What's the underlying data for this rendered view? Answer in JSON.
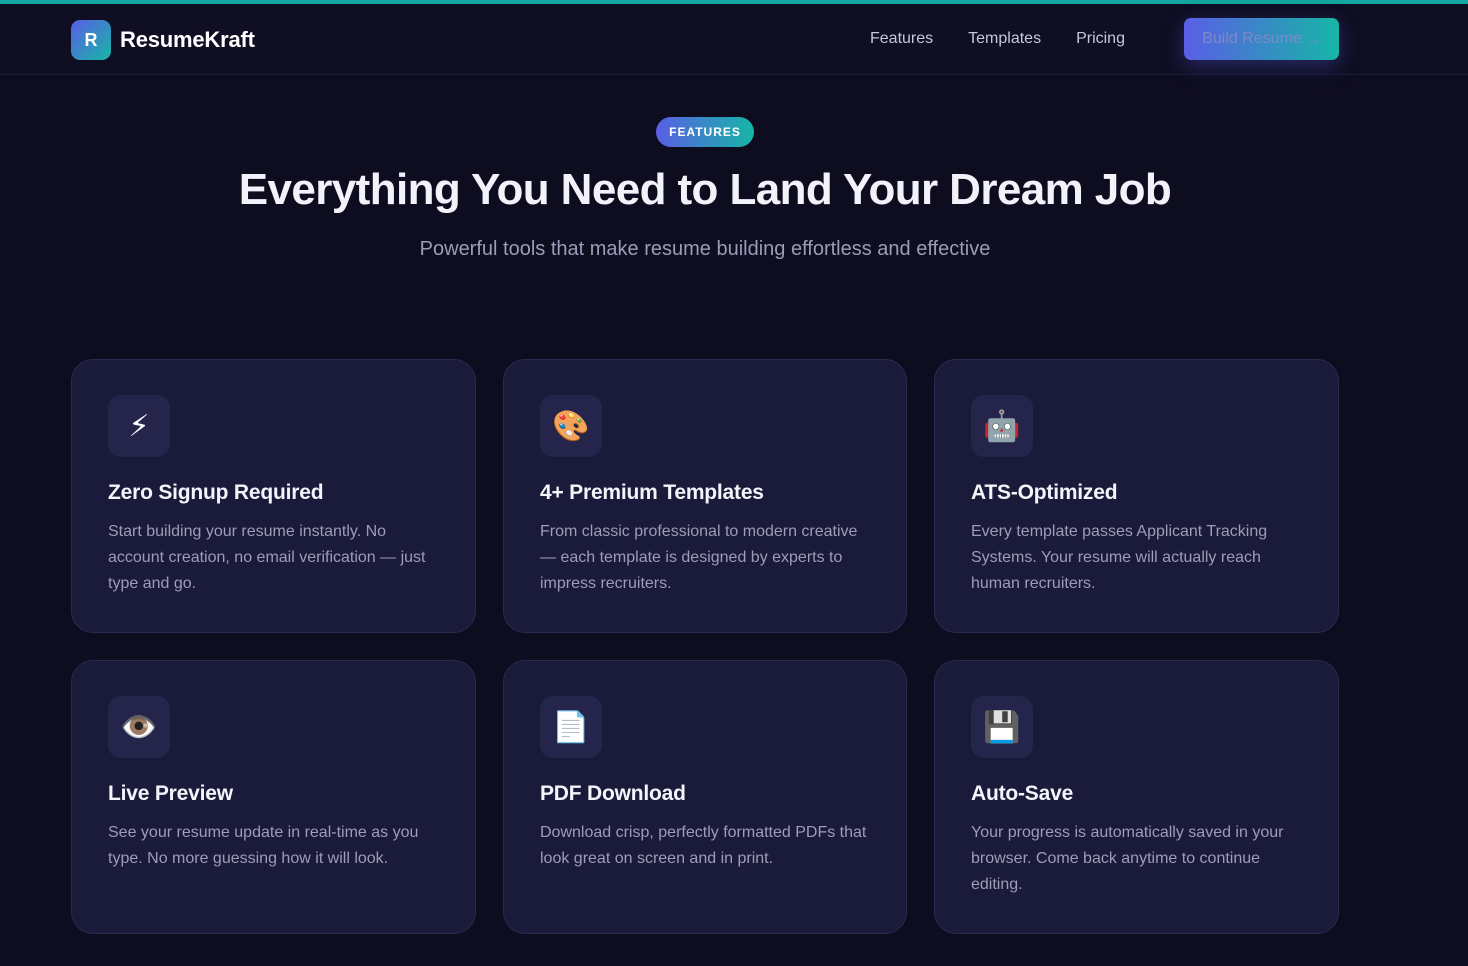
{
  "nav": {
    "logo_letter": "R",
    "brand": "ResumeKraft",
    "links": [
      "Features",
      "Templates",
      "Pricing"
    ],
    "cta_label": "Build Resume",
    "cta_arrow": "→"
  },
  "hero": {
    "badge": "FEATURES",
    "title": "Everything You Need to Land Your Dream Job",
    "subtitle": "Powerful tools that make resume building effortless and effective"
  },
  "features": [
    {
      "icon": "⚡",
      "icon_name": "lightning-icon",
      "title": "Zero Signup Required",
      "desc": "Start building your resume instantly. No account creation, no email verification — just type and go."
    },
    {
      "icon": "🎨",
      "icon_name": "palette-icon",
      "title": "4+ Premium Templates",
      "desc": "From classic professional to modern creative — each template is designed by experts to impress recruiters."
    },
    {
      "icon": "🤖",
      "icon_name": "robot-icon",
      "title": "ATS-Optimized",
      "desc": "Every template passes Applicant Tracking Systems. Your resume will actually reach human recruiters."
    },
    {
      "icon": "👁️",
      "icon_name": "eye-icon",
      "title": "Live Preview",
      "desc": "See your resume update in real-time as you type. No more guessing how it will look."
    },
    {
      "icon": "📄",
      "icon_name": "document-icon",
      "title": "PDF Download",
      "desc": "Download crisp, perfectly formatted PDFs that look great on screen and in print."
    },
    {
      "icon": "💾",
      "icon_name": "floppy-disk-icon",
      "title": "Auto-Save",
      "desc": "Your progress is automatically saved in your browser. Come back anytime to continue editing."
    }
  ],
  "colors": {
    "background": "#0e0c1f",
    "card": "#1a1a3a",
    "accent_start": "#5a5ee6",
    "accent_end": "#16b6a6"
  }
}
